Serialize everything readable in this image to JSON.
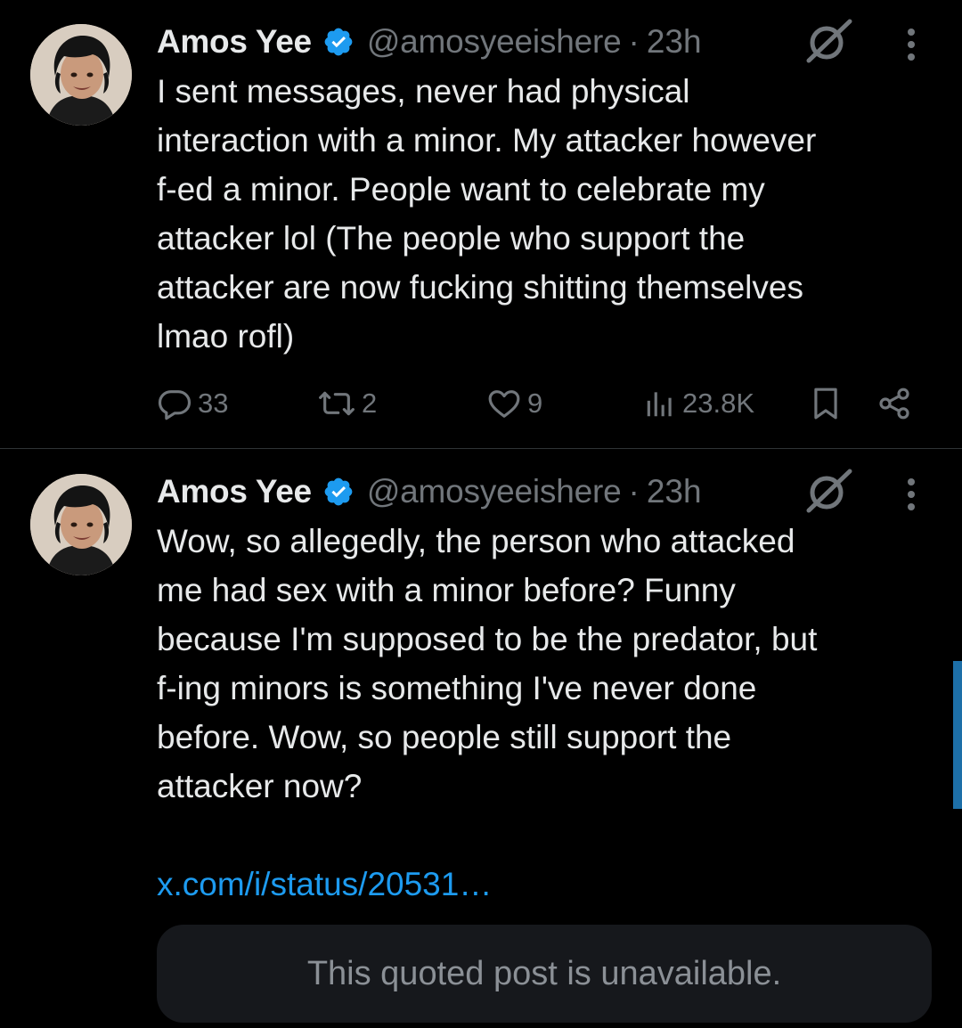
{
  "colors": {
    "background": "#000000",
    "text": "#e7e9ea",
    "muted": "#71767b",
    "link": "#1d9bf0",
    "verified": "#1d9bf0",
    "card": "#16181c"
  },
  "posts": [
    {
      "author_name": "Amos Yee",
      "handle": "@amosyeeishere",
      "separator": "·",
      "time": "23h",
      "lines": [
        "I sent messages, never had physical",
        "interaction with a minor. My attacker however",
        "f-ed a minor. People want to celebrate my",
        "attacker lol (The people who support the",
        "attacker are now fucking shitting themselves",
        "lmao rofl)"
      ],
      "replies": "33",
      "reposts": "2",
      "likes": "9",
      "views": "23.8K",
      "icons": {
        "verified": "verified-badge-icon",
        "grok": "grok-icon",
        "more": "more-options-icon",
        "reply": "reply-icon",
        "repost": "repost-icon",
        "like": "like-icon",
        "views": "views-icon",
        "bookmark": "bookmark-icon",
        "share": "share-icon"
      }
    },
    {
      "author_name": "Amos Yee",
      "handle": "@amosyeeishere",
      "separator": "·",
      "time": "23h",
      "lines": [
        "Wow, so allegedly, the person who attacked",
        "me had sex with a minor before? Funny",
        "because I'm supposed to be the predator, but",
        "f-ing minors is something I've never done",
        "before. Wow, so people still support the",
        "attacker now?"
      ],
      "link": "x.com/i/status/20531…",
      "quote_unavailable": "This quoted post is unavailable."
    }
  ]
}
